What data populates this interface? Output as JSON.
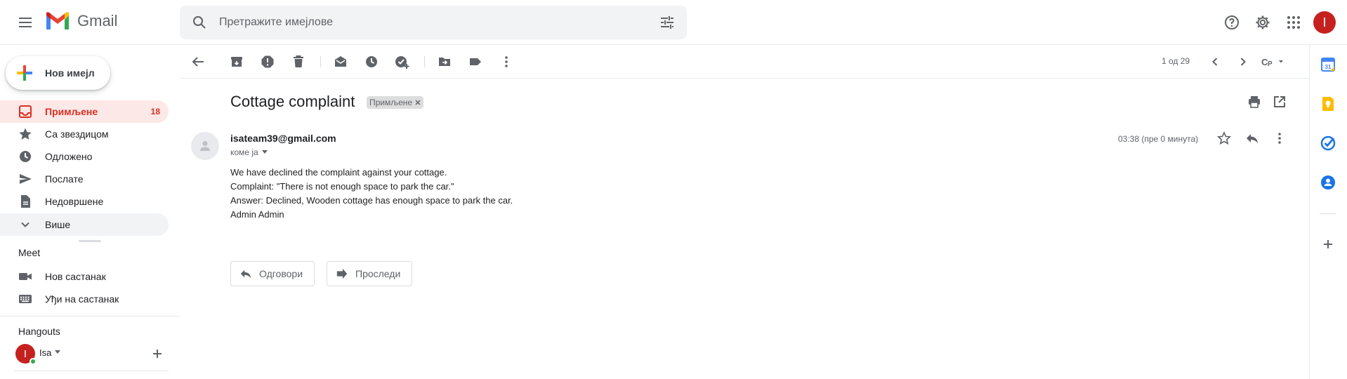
{
  "header": {
    "app_name": "Gmail",
    "search_placeholder": "Претражите имејлове",
    "avatar_letter": "I",
    "icons": [
      "menu-icon",
      "search-icon",
      "tune-icon",
      "help-icon",
      "settings-icon",
      "apps-icon"
    ]
  },
  "sidebar": {
    "compose_label": "Нов имејл",
    "items": [
      {
        "label": "Примљене",
        "count": "18",
        "icon": "inbox-icon",
        "active": true
      },
      {
        "label": "Са звездицом",
        "icon": "star-icon"
      },
      {
        "label": "Одложено",
        "icon": "clock-icon"
      },
      {
        "label": "Послате",
        "icon": "send-icon"
      },
      {
        "label": "Недовршене",
        "icon": "draft-icon"
      },
      {
        "label": "Више",
        "icon": "chevron-down-icon"
      }
    ],
    "meet": {
      "title": "Meet",
      "items": [
        {
          "label": "Нов састанак",
          "icon": "video-icon"
        },
        {
          "label": "Уђи на састанак",
          "icon": "keyboard-icon"
        }
      ]
    },
    "hangouts": {
      "title": "Hangouts",
      "user_initial": "I",
      "user_name": "Isa"
    }
  },
  "toolbar": {
    "pager_text": "1 од 29",
    "icons": [
      "back-icon",
      "archive-icon",
      "report-spam-icon",
      "delete-icon",
      "mark-unread-icon",
      "snooze-icon",
      "add-task-icon",
      "move-to-icon",
      "label-icon",
      "more-icon"
    ]
  },
  "message": {
    "subject": "Cottage complaint",
    "label_chip": "Примљене",
    "sender": "isateam39@gmail.com",
    "recipient": "коме ја",
    "time": "03:38 (пре 0 минута)",
    "body": [
      "We have declined the complaint against your cottage.",
      "Complaint: \"There is not enough space to park the car.\"",
      "Answer: Declined, Wooden cottage has enough space to park the car.",
      "Admin Admin"
    ],
    "reply_label": "Одговори",
    "forward_label": "Проследи"
  },
  "colors": {
    "accent_red": "#d93025",
    "active_bg": "#fce8e6",
    "avatar_red": "#c5221f"
  }
}
